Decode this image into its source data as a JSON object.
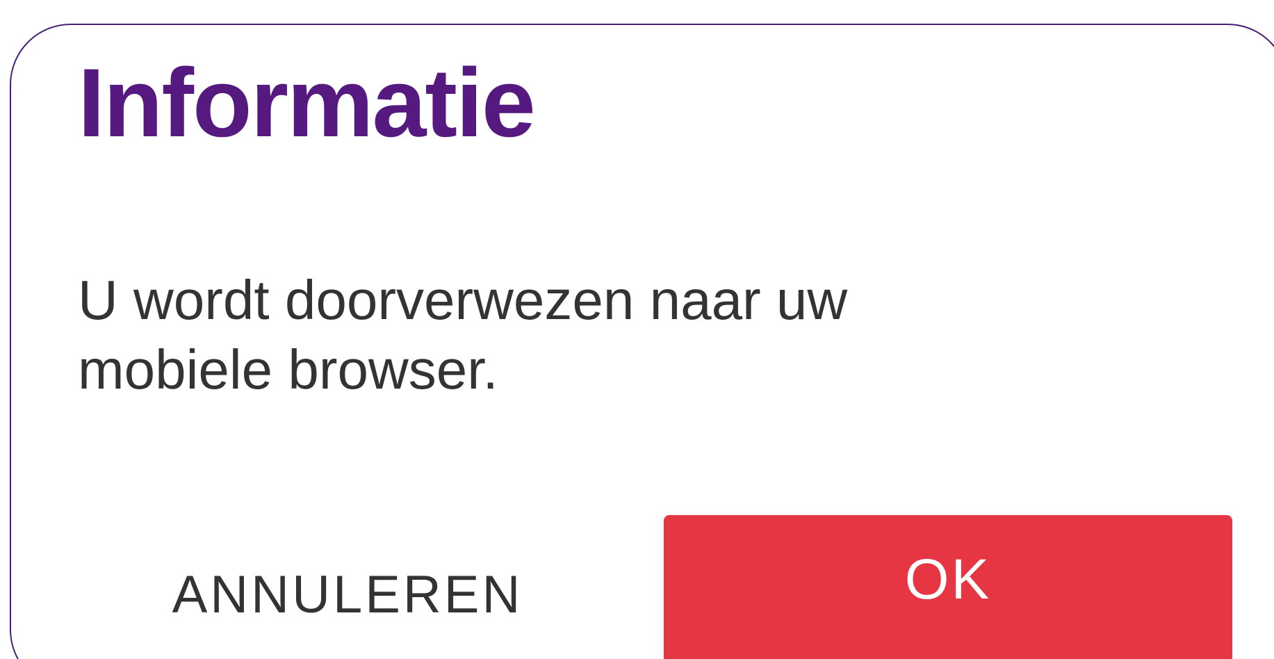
{
  "dialog": {
    "title": "Informatie",
    "message": "U wordt doorverwezen naar uw mobiele browser.",
    "buttons": {
      "cancel_label": "ANNULEREN",
      "ok_label": "OK"
    }
  },
  "colors": {
    "title": "#55197f",
    "border": "#4a1f7a",
    "ok_background": "#e63543",
    "text": "#333333"
  }
}
